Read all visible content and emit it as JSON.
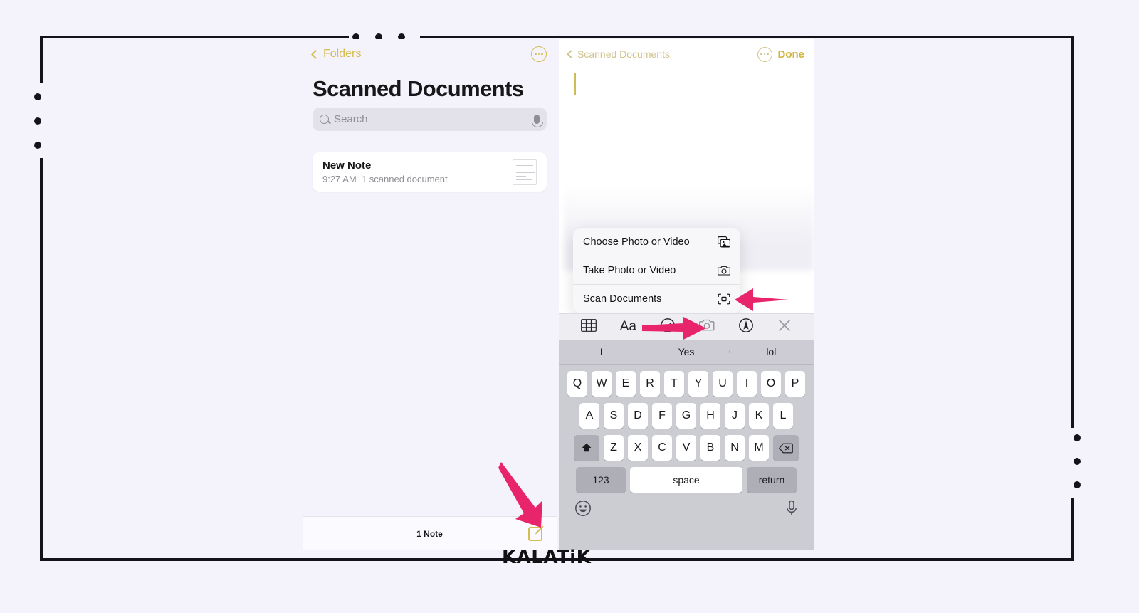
{
  "brand": {
    "text": "KALATiK"
  },
  "colors": {
    "background": "#f4f2fa",
    "frame": "#15121c",
    "accent_gold": "#d4bd52",
    "accent_gold_muted": "#cfc48c",
    "arrow_pink": "#e8256b",
    "card_white": "#ffffff",
    "keyboard_grey": "#ccccd3"
  },
  "left_panel": {
    "nav": {
      "back_label": "Folders",
      "more_icon": "ellipsis-circle-icon"
    },
    "title": "Scanned Documents",
    "search": {
      "placeholder": "Search",
      "search_icon": "search-icon",
      "mic_icon": "microphone-icon"
    },
    "notes": [
      {
        "title": "New Note",
        "time": "9:27 AM",
        "detail": "1 scanned document",
        "thumb_icon": "document-thumbnail-icon"
      }
    ],
    "bottom": {
      "count_label": "1 Note",
      "compose_icon": "compose-note-icon"
    }
  },
  "right_panel": {
    "nav": {
      "back_label": "Scanned Documents",
      "more_icon": "ellipsis-circle-icon",
      "done_label": "Done"
    },
    "body_text": "",
    "action_sheet": [
      {
        "label": "Choose Photo or Video",
        "icon": "photo-library-icon"
      },
      {
        "label": "Take Photo or Video",
        "icon": "camera-icon"
      },
      {
        "label": "Scan Documents",
        "icon": "scan-documents-icon"
      }
    ],
    "toolbar": [
      {
        "name": "table-icon",
        "label": ""
      },
      {
        "name": "text-format-icon",
        "label": "Aa"
      },
      {
        "name": "checklist-icon",
        "label": ""
      },
      {
        "name": "camera-icon",
        "label": ""
      },
      {
        "name": "markup-pen-icon",
        "label": ""
      },
      {
        "name": "close-icon",
        "label": ""
      }
    ],
    "keyboard": {
      "suggestions": [
        "I",
        "Yes",
        "lol"
      ],
      "row1": [
        "Q",
        "W",
        "E",
        "R",
        "T",
        "Y",
        "U",
        "I",
        "O",
        "P"
      ],
      "row2": [
        "A",
        "S",
        "D",
        "F",
        "G",
        "H",
        "J",
        "K",
        "L"
      ],
      "row3": [
        "Z",
        "X",
        "C",
        "V",
        "B",
        "N",
        "M"
      ],
      "shift_icon": "shift-icon",
      "delete_icon": "backspace-icon",
      "numbers_label": "123",
      "space_label": "space",
      "return_label": "return",
      "emoji_icon": "emoji-smiley-icon",
      "dictation_icon": "microphone-icon"
    }
  },
  "annotations": [
    {
      "name": "arrow-to-scan-documents",
      "direction": "left"
    },
    {
      "name": "arrow-to-camera-toolbar",
      "direction": "right"
    },
    {
      "name": "arrow-to-compose-button",
      "direction": "down-right"
    }
  ]
}
